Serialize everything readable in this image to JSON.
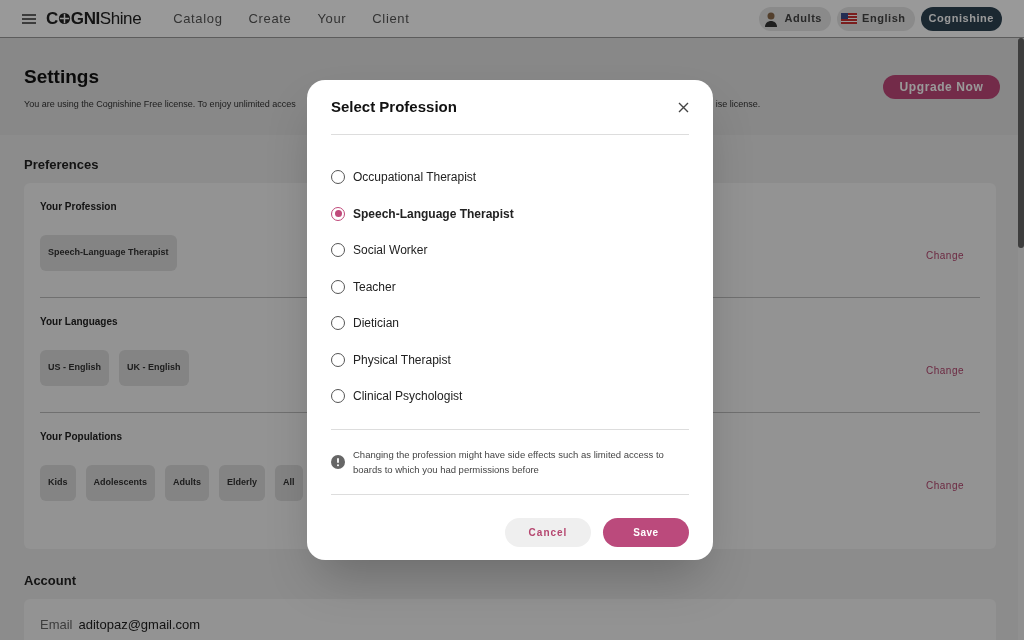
{
  "nav": {
    "logo": {
      "part_1": "C",
      "part_2": "GNI",
      "part_3": "Shine"
    },
    "links": [
      "Catalog",
      "Create",
      "Your",
      "Client"
    ],
    "population_chip": "Adults",
    "language_chip": "English",
    "account_button": "Cognishine"
  },
  "header": {
    "title": "Settings",
    "description_start": "You are using the Cognishine Free license. To enjoy unlimited acces",
    "description_end": "ise license.",
    "upgrade_button": "Upgrade Now"
  },
  "preferences": {
    "title": "Preferences",
    "sections": [
      {
        "label": "Your Profession",
        "chips": [
          "Speech-Language Therapist"
        ],
        "action": "Change"
      },
      {
        "label": "Your Languages",
        "chips": [
          "US - English",
          "UK - English"
        ],
        "action": "Change"
      },
      {
        "label": "Your Populations",
        "chips": [
          "Kids",
          "Adolescents",
          "Adults",
          "Elderly",
          "All"
        ],
        "action": "Change"
      }
    ]
  },
  "account": {
    "title": "Account",
    "email_label": "Email",
    "email_value": "aditopaz@gmail.com"
  },
  "dialog": {
    "title": "Select Profession",
    "options": [
      {
        "label": "Occupational Therapist",
        "selected": false
      },
      {
        "label": "Speech-Language Therapist",
        "selected": true
      },
      {
        "label": "Social Worker",
        "selected": false
      },
      {
        "label": "Teacher",
        "selected": false
      },
      {
        "label": "Dietician",
        "selected": false
      },
      {
        "label": "Physical Therapist",
        "selected": false
      },
      {
        "label": "Clinical Psychologist",
        "selected": false
      }
    ],
    "note": "Changing the profession might have side effects such as limited access to boards to which you had permissions before",
    "cancel_button": "Cancel",
    "save_button": "Save"
  }
}
